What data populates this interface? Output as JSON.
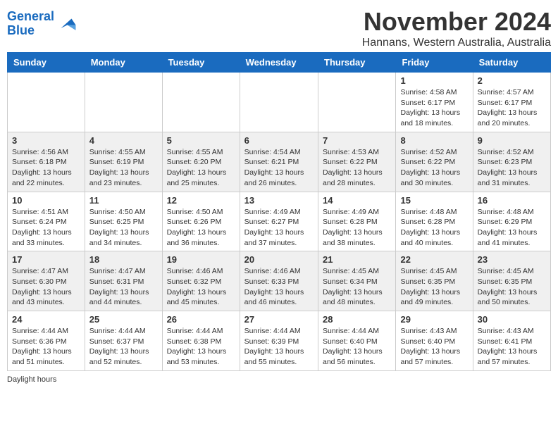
{
  "logo": {
    "line1": "General",
    "line2": "Blue"
  },
  "title": "November 2024",
  "location": "Hannans, Western Australia, Australia",
  "days_of_week": [
    "Sunday",
    "Monday",
    "Tuesday",
    "Wednesday",
    "Thursday",
    "Friday",
    "Saturday"
  ],
  "footer_text": "Daylight hours",
  "weeks": [
    [
      {
        "day": "",
        "info": ""
      },
      {
        "day": "",
        "info": ""
      },
      {
        "day": "",
        "info": ""
      },
      {
        "day": "",
        "info": ""
      },
      {
        "day": "",
        "info": ""
      },
      {
        "day": "1",
        "info": "Sunrise: 4:58 AM\nSunset: 6:17 PM\nDaylight: 13 hours\nand 18 minutes."
      },
      {
        "day": "2",
        "info": "Sunrise: 4:57 AM\nSunset: 6:17 PM\nDaylight: 13 hours\nand 20 minutes."
      }
    ],
    [
      {
        "day": "3",
        "info": "Sunrise: 4:56 AM\nSunset: 6:18 PM\nDaylight: 13 hours\nand 22 minutes."
      },
      {
        "day": "4",
        "info": "Sunrise: 4:55 AM\nSunset: 6:19 PM\nDaylight: 13 hours\nand 23 minutes."
      },
      {
        "day": "5",
        "info": "Sunrise: 4:55 AM\nSunset: 6:20 PM\nDaylight: 13 hours\nand 25 minutes."
      },
      {
        "day": "6",
        "info": "Sunrise: 4:54 AM\nSunset: 6:21 PM\nDaylight: 13 hours\nand 26 minutes."
      },
      {
        "day": "7",
        "info": "Sunrise: 4:53 AM\nSunset: 6:22 PM\nDaylight: 13 hours\nand 28 minutes."
      },
      {
        "day": "8",
        "info": "Sunrise: 4:52 AM\nSunset: 6:22 PM\nDaylight: 13 hours\nand 30 minutes."
      },
      {
        "day": "9",
        "info": "Sunrise: 4:52 AM\nSunset: 6:23 PM\nDaylight: 13 hours\nand 31 minutes."
      }
    ],
    [
      {
        "day": "10",
        "info": "Sunrise: 4:51 AM\nSunset: 6:24 PM\nDaylight: 13 hours\nand 33 minutes."
      },
      {
        "day": "11",
        "info": "Sunrise: 4:50 AM\nSunset: 6:25 PM\nDaylight: 13 hours\nand 34 minutes."
      },
      {
        "day": "12",
        "info": "Sunrise: 4:50 AM\nSunset: 6:26 PM\nDaylight: 13 hours\nand 36 minutes."
      },
      {
        "day": "13",
        "info": "Sunrise: 4:49 AM\nSunset: 6:27 PM\nDaylight: 13 hours\nand 37 minutes."
      },
      {
        "day": "14",
        "info": "Sunrise: 4:49 AM\nSunset: 6:28 PM\nDaylight: 13 hours\nand 38 minutes."
      },
      {
        "day": "15",
        "info": "Sunrise: 4:48 AM\nSunset: 6:28 PM\nDaylight: 13 hours\nand 40 minutes."
      },
      {
        "day": "16",
        "info": "Sunrise: 4:48 AM\nSunset: 6:29 PM\nDaylight: 13 hours\nand 41 minutes."
      }
    ],
    [
      {
        "day": "17",
        "info": "Sunrise: 4:47 AM\nSunset: 6:30 PM\nDaylight: 13 hours\nand 43 minutes."
      },
      {
        "day": "18",
        "info": "Sunrise: 4:47 AM\nSunset: 6:31 PM\nDaylight: 13 hours\nand 44 minutes."
      },
      {
        "day": "19",
        "info": "Sunrise: 4:46 AM\nSunset: 6:32 PM\nDaylight: 13 hours\nand 45 minutes."
      },
      {
        "day": "20",
        "info": "Sunrise: 4:46 AM\nSunset: 6:33 PM\nDaylight: 13 hours\nand 46 minutes."
      },
      {
        "day": "21",
        "info": "Sunrise: 4:45 AM\nSunset: 6:34 PM\nDaylight: 13 hours\nand 48 minutes."
      },
      {
        "day": "22",
        "info": "Sunrise: 4:45 AM\nSunset: 6:35 PM\nDaylight: 13 hours\nand 49 minutes."
      },
      {
        "day": "23",
        "info": "Sunrise: 4:45 AM\nSunset: 6:35 PM\nDaylight: 13 hours\nand 50 minutes."
      }
    ],
    [
      {
        "day": "24",
        "info": "Sunrise: 4:44 AM\nSunset: 6:36 PM\nDaylight: 13 hours\nand 51 minutes."
      },
      {
        "day": "25",
        "info": "Sunrise: 4:44 AM\nSunset: 6:37 PM\nDaylight: 13 hours\nand 52 minutes."
      },
      {
        "day": "26",
        "info": "Sunrise: 4:44 AM\nSunset: 6:38 PM\nDaylight: 13 hours\nand 53 minutes."
      },
      {
        "day": "27",
        "info": "Sunrise: 4:44 AM\nSunset: 6:39 PM\nDaylight: 13 hours\nand 55 minutes."
      },
      {
        "day": "28",
        "info": "Sunrise: 4:44 AM\nSunset: 6:40 PM\nDaylight: 13 hours\nand 56 minutes."
      },
      {
        "day": "29",
        "info": "Sunrise: 4:43 AM\nSunset: 6:40 PM\nDaylight: 13 hours\nand 57 minutes."
      },
      {
        "day": "30",
        "info": "Sunrise: 4:43 AM\nSunset: 6:41 PM\nDaylight: 13 hours\nand 57 minutes."
      }
    ]
  ]
}
